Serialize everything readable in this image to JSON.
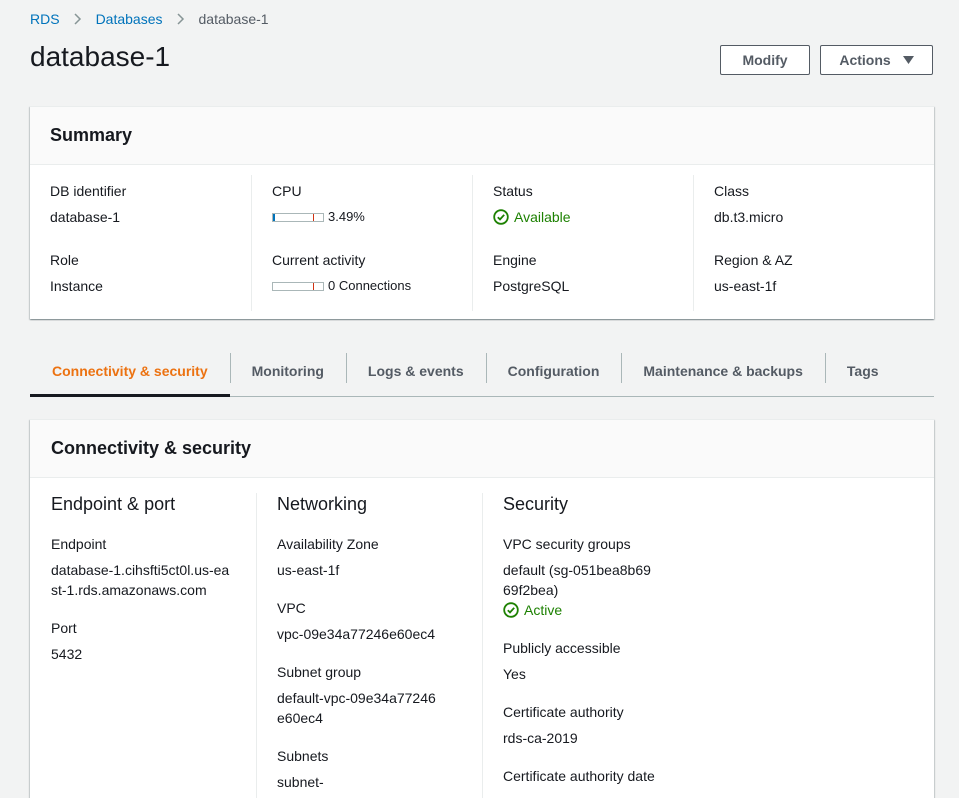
{
  "breadcrumb": {
    "items": [
      "RDS",
      "Databases"
    ],
    "current": "database-1"
  },
  "page": {
    "title": "database-1",
    "modify_label": "Modify",
    "actions_label": "Actions"
  },
  "summary": {
    "title": "Summary",
    "db_identifier_label": "DB identifier",
    "db_identifier": "database-1",
    "role_label": "Role",
    "role": "Instance",
    "cpu_label": "CPU",
    "cpu_value": "3.49%",
    "cpu_percent": 3.49,
    "current_activity_label": "Current activity",
    "current_activity": "0 Connections",
    "current_activity_level": 0,
    "status_label": "Status",
    "status": "Available",
    "engine_label": "Engine",
    "engine": "PostgreSQL",
    "class_label": "Class",
    "class": "db.t3.micro",
    "region_label": "Region & AZ",
    "region": "us-east-1f"
  },
  "tabs": [
    {
      "label": "Connectivity & security",
      "active": true
    },
    {
      "label": "Monitoring",
      "active": false
    },
    {
      "label": "Logs & events",
      "active": false
    },
    {
      "label": "Configuration",
      "active": false
    },
    {
      "label": "Maintenance & backups",
      "active": false
    },
    {
      "label": "Tags",
      "active": false
    }
  ],
  "connectivity": {
    "title": "Connectivity & security",
    "endpoint_port": {
      "title": "Endpoint & port",
      "endpoint_label": "Endpoint",
      "endpoint": "database-1.cihsfti5ct0l.us-east-1.rds.amazonaws.com",
      "port_label": "Port",
      "port": "5432"
    },
    "networking": {
      "title": "Networking",
      "az_label": "Availability Zone",
      "az": "us-east-1f",
      "vpc_label": "VPC",
      "vpc": "vpc-09e34a77246e60ec4",
      "subnet_group_label": "Subnet group",
      "subnet_group": "default-vpc-09e34a77246e60ec4",
      "subnets_label": "Subnets",
      "subnets": "subnet-"
    },
    "security": {
      "title": "Security",
      "vpc_sg_label": "VPC security groups",
      "vpc_sg": "default (sg-051bea8b6969f2bea)",
      "vpc_sg_status": "Active",
      "public_label": "Publicly accessible",
      "public": "Yes",
      "ca_label": "Certificate authority",
      "ca": "rds-ca-2019",
      "ca_date_label": "Certificate authority date"
    }
  },
  "colors": {
    "accent_tab": "#ec7211",
    "link": "#0073bb",
    "success": "#1d8102"
  }
}
